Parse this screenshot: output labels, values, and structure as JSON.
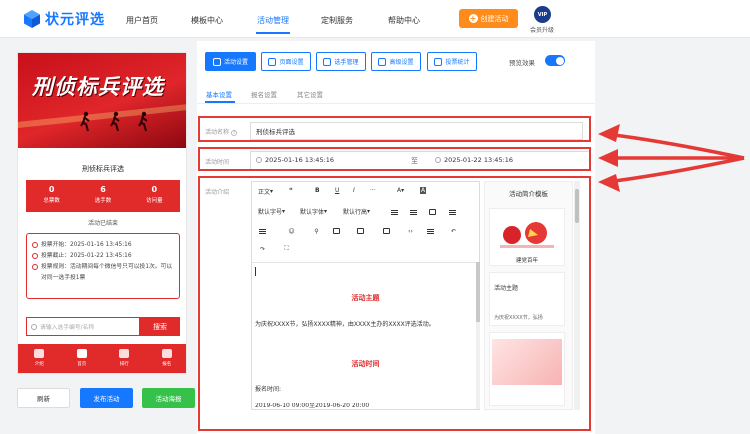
{
  "nav": {
    "logo_text": "状元评选",
    "items": [
      "用户首页",
      "模板中心",
      "活动管理",
      "定制服务",
      "帮助中心"
    ],
    "active_index": 2,
    "create_button": "创建活动",
    "vip_badge": "VIP",
    "vip_label": "会员升级"
  },
  "phone": {
    "banner_title": "刑侦标兵评选",
    "title": "刑侦标兵评选",
    "stats": [
      {
        "value": "0",
        "label": "总票数"
      },
      {
        "value": "6",
        "label": "选手数"
      },
      {
        "value": "0",
        "label": "访问量"
      }
    ],
    "status": "活动已结束",
    "info": [
      "投票开始：2025-01-16 13:45:16",
      "投票截止：2025-01-22 13:45:16",
      "投票规则：活动期间每个微信号只可以投1次。可以对同一选手投1票"
    ],
    "search_placeholder": "请输入选手编号/名称",
    "search_button": "搜索",
    "tabs": [
      "介绍",
      "首页",
      "排行",
      "报名"
    ],
    "active_tab": 1
  },
  "bottom_buttons": {
    "refresh": "刷新",
    "publish": "发布活动",
    "poster": "活动海报"
  },
  "toolbar": {
    "buttons": [
      "活动设置",
      "页面设置",
      "选手管理",
      "高级设置",
      "投票统计"
    ],
    "active_index": 0,
    "preview_label": "预览效果",
    "preview_on": true
  },
  "subtabs": {
    "items": [
      "基本设置",
      "报名设置",
      "其它设置"
    ],
    "active_index": 0
  },
  "form": {
    "name_label": "活动名称",
    "name_value": "刑侦标兵评选",
    "time_label": "活动时间",
    "time_start": "2025-01-16 13:45:16",
    "time_sep": "至",
    "time_end": "2025-01-22 13:45:16",
    "intro_label": "活动介绍"
  },
  "editor": {
    "toolbar_row1": [
      "正文",
      "❝",
      "B",
      "U",
      "I",
      "···",
      "A",
      "A"
    ],
    "toolbar_row2": [
      "默认字号",
      "默认字体",
      "默认行高"
    ],
    "content": {
      "heading1": "活动主题",
      "para1": "为庆祝XXXX节，弘扬XXXX精神，由XXXX主办的XXXX评选活动。",
      "heading2": "活动时间",
      "para2": "报名时间:",
      "para3": "2019-06-10 09:00至2019-06-20 20:00"
    }
  },
  "templates": {
    "title": "活动简介模板",
    "cards": [
      "建党百年",
      "活动主题",
      "为庆祝XXXX节，弘扬"
    ]
  },
  "colors": {
    "accent": "#1677ff",
    "brand_red": "#e12b2b",
    "orange": "#ff8c1a",
    "highlight": "#e53935"
  }
}
